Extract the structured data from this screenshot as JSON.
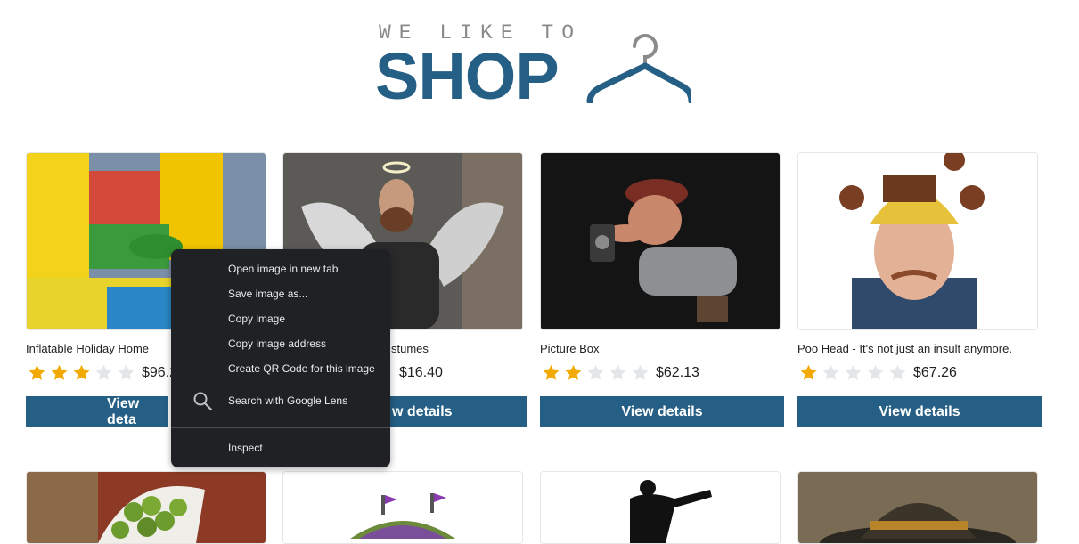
{
  "logo": {
    "top_text": "WE LIKE TO",
    "main_text": "SHOP"
  },
  "colors": {
    "brand": "#255f85",
    "star_filled": "#f2a900",
    "star_empty": "#e3e6e8"
  },
  "products": [
    {
      "title": "Inflatable Holiday Home",
      "rating": 3,
      "price": "$96.2",
      "button": "View deta"
    },
    {
      "title": "stumes",
      "rating": 0,
      "price": "$16.40",
      "button": "w details"
    },
    {
      "title": "Picture Box",
      "rating": 2,
      "price": "$62.13",
      "button": "View details"
    },
    {
      "title": "Poo Head - It's not just an insult anymore.",
      "rating": 1,
      "price": "$67.26",
      "button": "View details"
    }
  ],
  "context_menu": {
    "items": [
      "Open image in new tab",
      "Save image as...",
      "Copy image",
      "Copy image address",
      "Create QR Code for this image",
      "Search with Google Lens",
      "Inspect"
    ]
  }
}
